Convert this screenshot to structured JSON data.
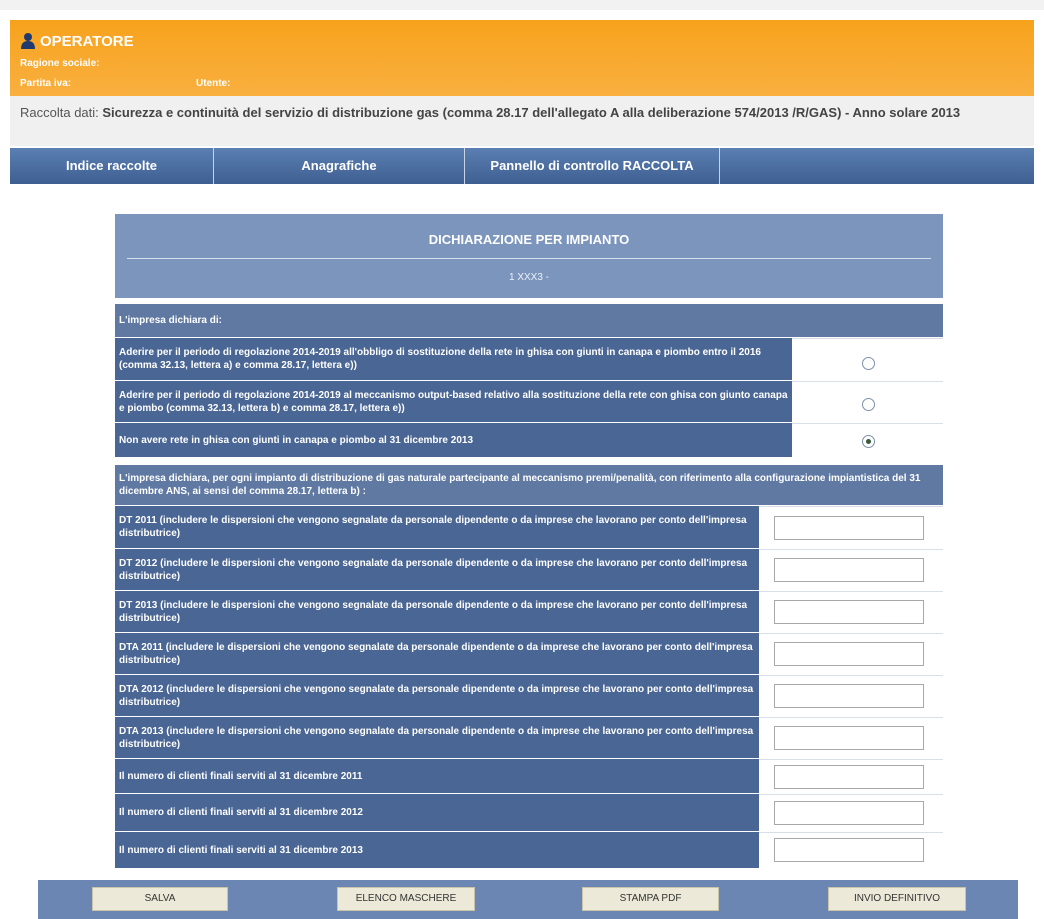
{
  "header": {
    "title": "OPERATORE",
    "ragione_label": "Ragione sociale:",
    "partita_label": "Partita iva:",
    "utente_label": "Utente:"
  },
  "info": {
    "prefix": "Raccolta dati: ",
    "text": "Sicurezza e continuità del servizio di distribuzione gas (comma 28.17 dell'allegato A alla deliberazione 574/2013 /R/GAS) - Anno solare 2013"
  },
  "nav": {
    "items": [
      {
        "label": "Indice raccolte"
      },
      {
        "label": "Anagrafiche"
      },
      {
        "label": "Pannello di controllo RACCOLTA"
      }
    ]
  },
  "panel": {
    "title": "DICHIARAZIONE PER IMPIANTO",
    "subtitle": "1 XXX3 -"
  },
  "section1": {
    "heading": "L'impresa dichiara di:",
    "options": [
      {
        "label": "Aderire per il periodo di regolazione 2014-2019 all'obbligo di sostituzione della rete in ghisa con giunti in canapa e piombo entro il 2016 (comma 32.13, lettera a) e comma 28.17, lettera e))",
        "selected": false
      },
      {
        "label": "Aderire per il periodo di regolazione 2014-2019 al meccanismo output-based relativo alla sostituzione della rete con ghisa con giunto canapa e piombo (comma 32.13, lettera b) e comma 28.17, lettera e))",
        "selected": false
      },
      {
        "label": "Non avere rete in ghisa con giunti in canapa e piombo al 31 dicembre 2013",
        "selected": true
      }
    ]
  },
  "section2": {
    "heading": "L'impresa dichiara, per ogni impianto di distribuzione di gas naturale partecipante al meccanismo premi/penalità, con riferimento alla configurazione impiantistica del 31 dicembre ANS, ai sensi del comma 28.17, lettera b) :",
    "fields": [
      {
        "label": "DT 2011 (includere le dispersioni che vengono segnalate da personale dipendente o da imprese che lavorano per conto dell'impresa distributrice)",
        "value": ""
      },
      {
        "label": "DT 2012 (includere le dispersioni che vengono segnalate da personale dipendente o da imprese che lavorano per conto dell'impresa distributrice)",
        "value": ""
      },
      {
        "label": "DT 2013 (includere le dispersioni che vengono segnalate da personale dipendente o da imprese che lavorano per conto dell'impresa distributrice)",
        "value": ""
      },
      {
        "label": "DTA 2011 (includere le dispersioni che vengono segnalate da personale dipendente o da imprese che lavorano per conto dell'impresa distributrice)",
        "value": ""
      },
      {
        "label": "DTA 2012 (includere le dispersioni che vengono segnalate da personale dipendente o da imprese che lavorano per conto dell'impresa distributrice)",
        "value": ""
      },
      {
        "label": "DTA 2013 (includere le dispersioni che vengono segnalate da personale dipendente o da imprese che lavorano per conto dell'impresa distributrice)",
        "value": ""
      },
      {
        "label": "Il numero di clienti finali serviti al 31 dicembre 2011",
        "value": ""
      },
      {
        "label": "Il numero di clienti finali serviti al 31 dicembre 2012",
        "value": ""
      },
      {
        "label": "Il numero di clienti finali serviti al 31 dicembre 2013",
        "value": ""
      }
    ]
  },
  "footer": {
    "save": "SALVA",
    "elenco": "ELENCO MASCHERE",
    "stampa": "STAMPA PDF",
    "invio": "INVIO DEFINITIVO"
  },
  "colors": {
    "header_orange": "#f7a21c",
    "nav_blue": "#4a6694",
    "label_blue": "#4a6694",
    "panel_blue": "#7b95bd"
  },
  "icons": {
    "operator": "user-icon"
  }
}
